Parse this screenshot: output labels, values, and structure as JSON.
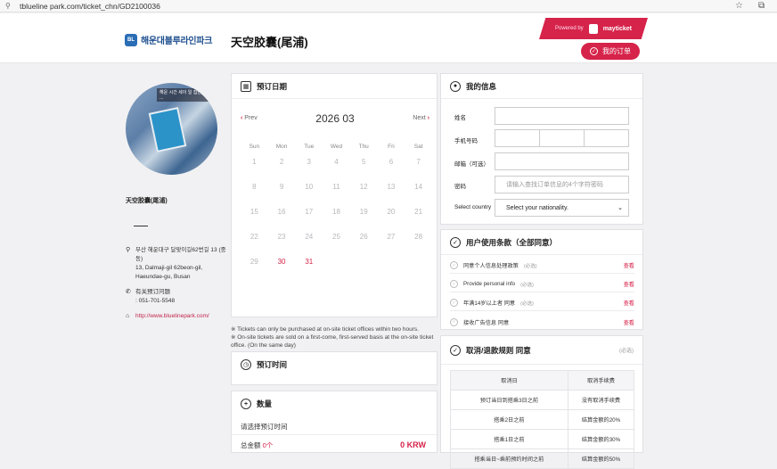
{
  "browser": {
    "url": "tblueline park.com/ticket_chn/GD2100036"
  },
  "header": {
    "logo_text": "해운대블루라인파크",
    "title": "天空胶囊(尾浦)",
    "powered_label": "Powered by",
    "powered_brand": "mayticket",
    "my_order": "我的订单"
  },
  "venue": {
    "photo_sign": "해운 시간 세이 일 집안 입장 ...",
    "name": "天空胶囊(尾浦)",
    "address_ko": "부산 해운대구 달맞이길62번길 13 (중동)",
    "address_en": "13, Dalmaji-gil 62beon-gil, Haeundae-gu, Busan",
    "phone_label": "有关预订问题",
    "phone": ": 051-701-5548",
    "website": "http://www.bluelinepark.com/"
  },
  "calendar": {
    "title": "预订日期",
    "prev": "Prev",
    "next": "Next",
    "month": "2026 03",
    "weekdays": [
      "Sun",
      "Mon",
      "Tue",
      "Wed",
      "Thu",
      "Fri",
      "Sat"
    ],
    "days": [
      "1",
      "2",
      "3",
      "4",
      "5",
      "6",
      "7",
      "8",
      "9",
      "10",
      "11",
      "12",
      "13",
      "14",
      "15",
      "16",
      "17",
      "18",
      "19",
      "20",
      "21",
      "22",
      "23",
      "24",
      "25",
      "26",
      "27",
      "28",
      "29",
      "30",
      "31"
    ],
    "available_days": [
      "30",
      "31"
    ]
  },
  "notes": [
    "※ Tickets can only be purchased at on-site ticket offices within two hours.",
    "※ On-site tickets are sold on a first-come, first-served basis at the on-site ticket office. (On the same day)"
  ],
  "booking_time": {
    "title": "预订时间"
  },
  "quantity": {
    "title": "数量",
    "hint": "请选择预订时间",
    "total_label": "总金额",
    "total_count": "0个",
    "total_amount": "0 KRW"
  },
  "my_info": {
    "title": "我的信息",
    "name_label": "姓名",
    "phone_label": "手机号码",
    "email_label": "邮箱（可选）",
    "password_label": "密码",
    "password_placeholder": "请输入查找订单信息的4个字符密码",
    "country_label": "Select country",
    "country_value": "Select your nationality."
  },
  "terms": {
    "title": "用户使用条款（全部同意）",
    "items": [
      {
        "label": "同意个人信息处理政策",
        "req": "(必选)",
        "view": "查看"
      },
      {
        "label": "Provide personal info",
        "req": "(必选)",
        "view": "查看"
      },
      {
        "label": "年满14岁以上者 同意",
        "req": "(必选)",
        "view": "查看"
      },
      {
        "label": "接收广告信息 同意",
        "req": "",
        "view": "查看"
      }
    ]
  },
  "refund": {
    "title": "取消/退款规则 同意",
    "req": "(必选)",
    "headers": [
      "取消日",
      "取消手续费"
    ],
    "rows": [
      [
        "预订当日到搭乘3日之前",
        "没有取消手续费"
      ],
      [
        "搭乘2日之前",
        "结算金额的20%"
      ],
      [
        "搭乘1日之前",
        "结算金额的30%"
      ],
      [
        "搭乘当日~乘前预约时间之前",
        "结算金额的50%"
      ]
    ]
  },
  "colors": {
    "accent": "#d6234a",
    "brand": "#1e4f8f"
  }
}
